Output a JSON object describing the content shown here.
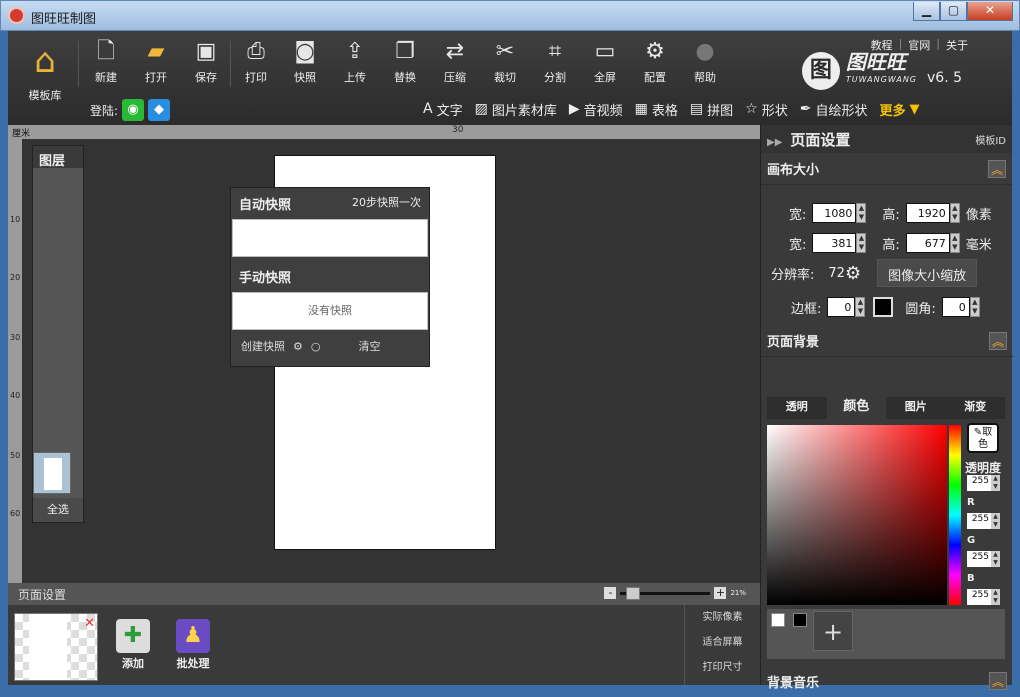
{
  "window": {
    "title": "图旺旺制图"
  },
  "toolbar": {
    "home_label": "模板库",
    "tools": [
      "新建",
      "打开",
      "保存",
      "打印",
      "快照",
      "上传",
      "替换",
      "压缩",
      "裁切",
      "分割",
      "全屏",
      "配置",
      "帮助"
    ],
    "top_links": [
      "教程",
      "官网",
      "关于"
    ],
    "logo_text": "图旺旺",
    "logo_sub": "TUWANGWANG",
    "version": "v6. 5",
    "login_label": "登陆:"
  },
  "secbar": {
    "items": [
      "文字",
      "图片素材库",
      "音视频",
      "表格",
      "拼图",
      "形状",
      "自绘形状"
    ],
    "more": "更多"
  },
  "ruler": {
    "unit": "厘米",
    "top_ticks": [
      "30"
    ],
    "left_ticks": [
      "10",
      "20",
      "30",
      "40",
      "50",
      "60"
    ]
  },
  "layers": {
    "title": "图层",
    "select_all": "全选"
  },
  "snapshot": {
    "auto_title": "自动快照",
    "auto_hint": "20步快照一次",
    "manual_title": "手动快照",
    "empty": "没有快照",
    "create": "创建快照",
    "clear": "清空"
  },
  "pagebar": {
    "label": "页面设置",
    "zoom": "21%"
  },
  "bottom": {
    "add": "添加",
    "batch": "批处理",
    "actual": "实际像素",
    "fit": "适合屏幕",
    "print": "打印尺寸"
  },
  "panel": {
    "title": "页面设置",
    "template_id": "模板ID",
    "canvas_size": "画布大小",
    "w_label": "宽:",
    "h_label": "高:",
    "px": "像素",
    "mm": "毫米",
    "w_px": "1080",
    "h_px": "1920",
    "w_mm": "381",
    "h_mm": "677",
    "dpi_label": "分辨率:",
    "dpi": "72",
    "scale_btn": "图像大小缩放",
    "border_label": "边框:",
    "border": "0",
    "radius_label": "圆角:",
    "radius": "0",
    "bg_title": "页面背景",
    "tabs": [
      "透明",
      "颜色",
      "图片",
      "渐变"
    ],
    "pick": "取色",
    "alpha_label": "透明度",
    "alpha": "255",
    "r_label": "R",
    "r": "255",
    "g_label": "G",
    "g": "255",
    "b_label": "B",
    "b": "255",
    "music_title": "背景音乐",
    "accent": "#f5c400"
  }
}
